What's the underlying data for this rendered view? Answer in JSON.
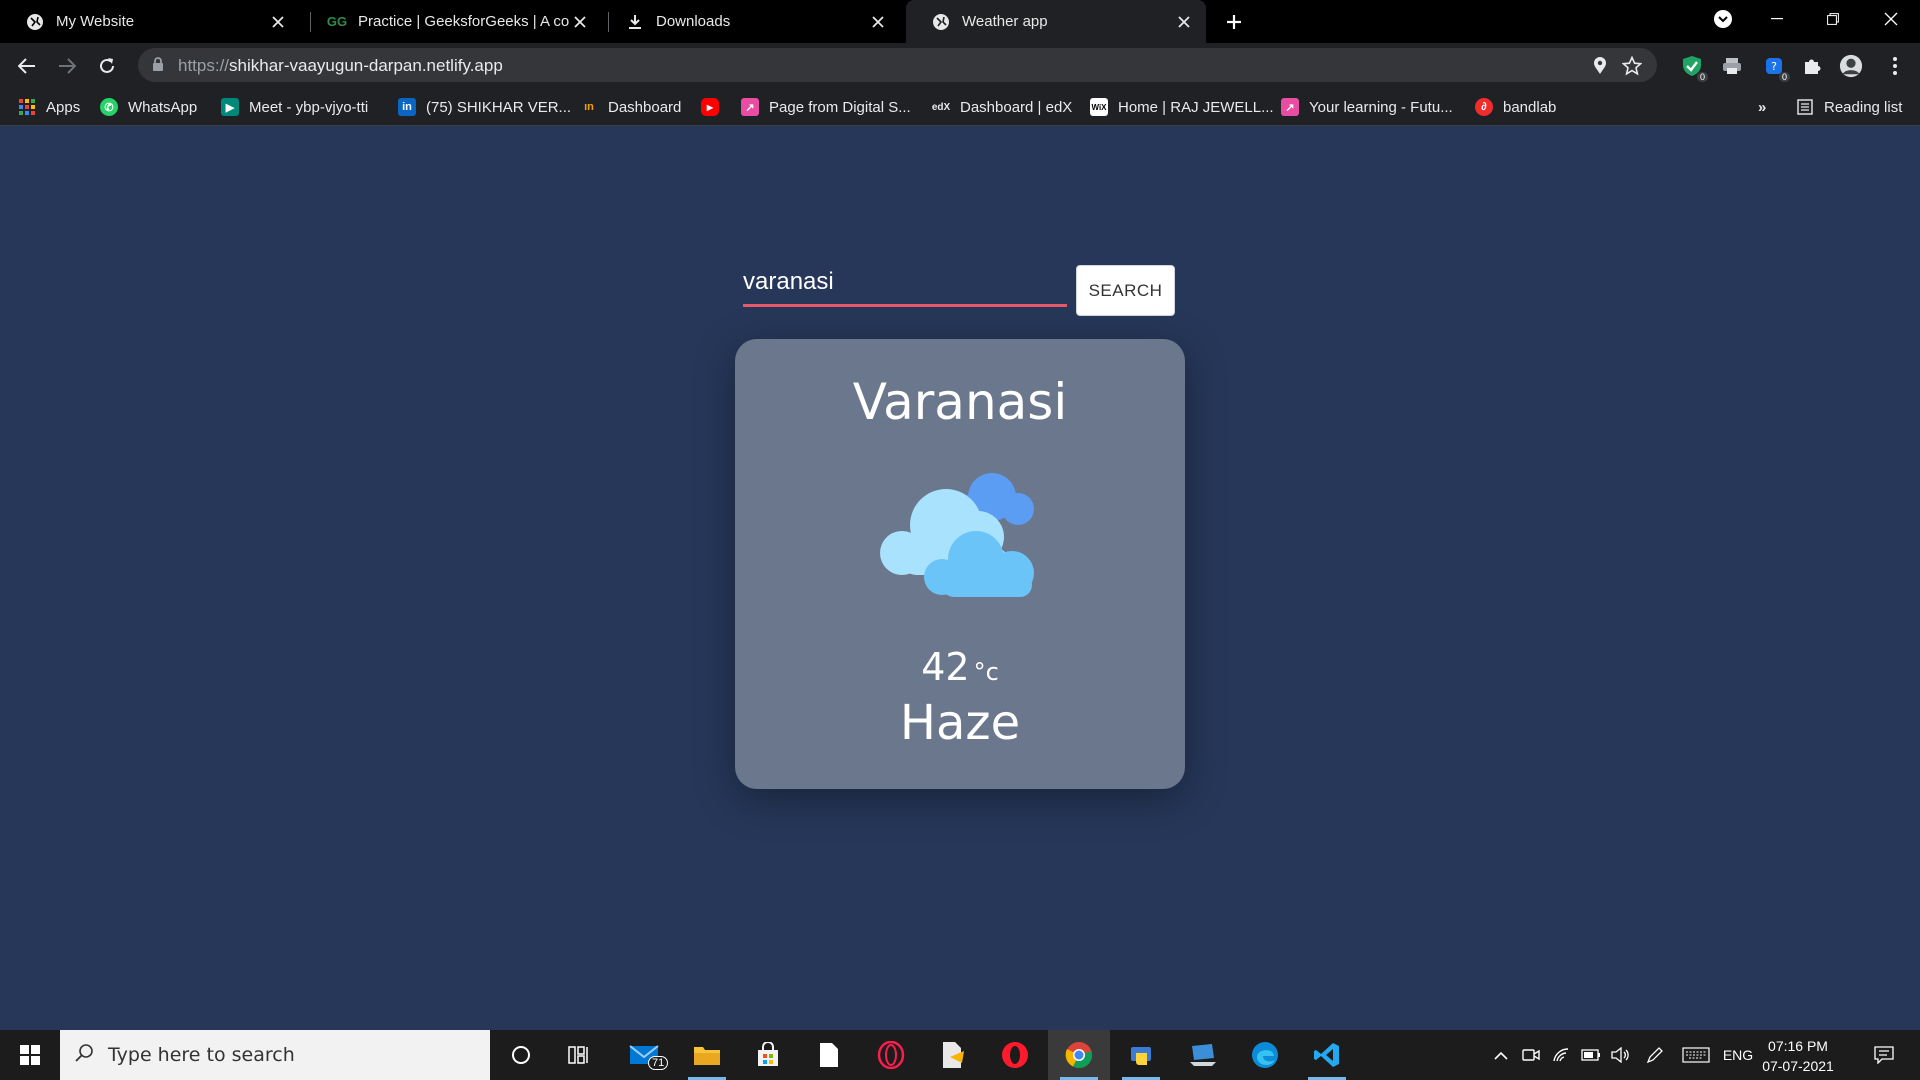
{
  "browser": {
    "tabs": [
      {
        "title": "My Website",
        "icon": "globe-icon"
      },
      {
        "title": "Practice | GeeksforGeeks | A com",
        "icon": "geeksforgeeks-icon"
      },
      {
        "title": "Downloads",
        "icon": "download-icon"
      },
      {
        "title": "Weather app",
        "icon": "globe-icon",
        "active": true
      }
    ],
    "url_scheme": "https://",
    "url_host": "shikhar-vaayugun-darpan.netlify.app",
    "extension_badges": [
      "0",
      "0"
    ],
    "bookmarks": [
      {
        "label": "Apps",
        "icon": "apps-grid-icon",
        "color": "#4285f4"
      },
      {
        "label": "WhatsApp",
        "icon": "whatsapp-icon",
        "color": "#25d366"
      },
      {
        "label": "Meet - ybp-vjyo-tti",
        "icon": "google-meet-icon",
        "color": "#00897b"
      },
      {
        "label": "(75) SHIKHAR VER...",
        "icon": "linkedin-icon",
        "color": "#0a66c2"
      },
      {
        "label": "Dashboard",
        "icon": "dashboard-icon",
        "color": "#f4a100"
      },
      {
        "label": "",
        "icon": "youtube-icon",
        "color": "#ff0000"
      },
      {
        "label": "Page from Digital S...",
        "icon": "page-icon",
        "color": "#e94da3"
      },
      {
        "label": "Dashboard | edX",
        "icon": "edx-icon",
        "color": "#202124"
      },
      {
        "label": "Home | RAJ JEWELL...",
        "icon": "wix-icon",
        "color": "#ffffff"
      },
      {
        "label": "Your learning - Futu...",
        "icon": "futurelearn-icon",
        "color": "#e94da3"
      },
      {
        "label": "bandlab",
        "icon": "bandlab-icon",
        "color": "#f12c2c"
      }
    ],
    "overflow_label": "»",
    "reading_list_label": "Reading list"
  },
  "weather_app": {
    "search_value": "varanasi",
    "search_button_label": "SEARCH",
    "city": "Varanasi",
    "temperature": "42",
    "temperature_unit": "°c",
    "condition": "Haze",
    "weather_icon": "clouds-icon",
    "colors": {
      "background": "#263759",
      "card": "#6b778c",
      "input_underline": "#e85a6a"
    }
  },
  "taskbar": {
    "search_placeholder": "Type here to search",
    "mail_badge": "71",
    "language": "ENG",
    "time": "07:16 PM",
    "date": "07-07-2021"
  }
}
